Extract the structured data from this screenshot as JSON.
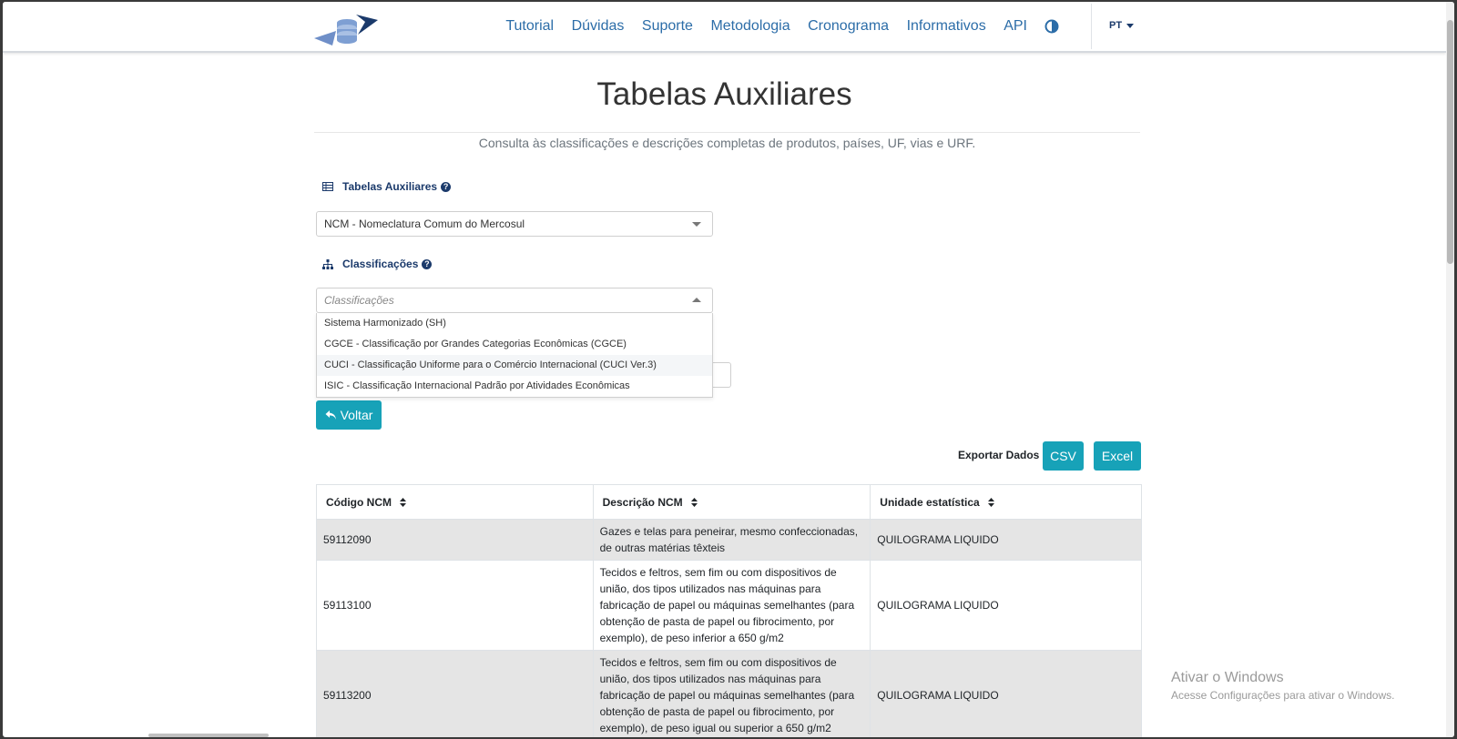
{
  "nav": {
    "links": [
      "Tutorial",
      "Dúvidas",
      "Suporte",
      "Metodologia",
      "Cronograma",
      "Informativos",
      "API"
    ],
    "lang": "PT"
  },
  "page": {
    "title": "Tabelas Auxiliares",
    "subtitle": "Consulta às classificações e descrições completas de produtos, países, UF, vias e URF."
  },
  "tabelas": {
    "label": "Tabelas Auxiliares",
    "selected": "NCM - Nomeclatura Comum do Mercosul"
  },
  "classificacoes": {
    "label": "Classificações",
    "placeholder": "Classificações",
    "options": [
      "Sistema Harmonizado (SH)",
      "CGCE - Classificação por Grandes Categorias Econômicas (CGCE)",
      "CUCI - Classificação Uniforme para o Comércio Internacional (CUCI Ver.3)",
      "ISIC - Classificação Internacional Padrão por Atividades Econômicas"
    ]
  },
  "buttons": {
    "voltar": "Voltar",
    "export_label": "Exportar Dados",
    "csv": "CSV",
    "excel": "Excel"
  },
  "table": {
    "headers": [
      "Código NCM",
      "Descrição NCM",
      "Unidade estatística"
    ],
    "rows": [
      [
        "59112090",
        "Gazes e telas para peneirar, mesmo confeccionadas, de outras matérias têxteis",
        "QUILOGRAMA LIQUIDO"
      ],
      [
        "59113100",
        "Tecidos e feltros, sem fim ou com dispositivos de união, dos tipos utilizados nas máquinas para fabricação de papel ou máquinas semelhantes (para obtenção de pasta de papel ou fibrocimento, por exemplo), de peso inferior a 650 g/m2",
        "QUILOGRAMA LIQUIDO"
      ],
      [
        "59113200",
        "Tecidos e feltros, sem fim ou com dispositivos de união, dos tipos utilizados nas máquinas para fabricação de papel ou máquinas semelhantes (para obtenção de pasta de papel ou fibrocimento, por exemplo), de peso igual ou superior a 650 g/m2",
        "QUILOGRAMA LIQUIDO"
      ]
    ]
  },
  "watermark": {
    "title": "Ativar o Windows",
    "subtitle": "Acesse Configurações para ativar o Windows."
  },
  "colors": {
    "accent": "#17a2b8",
    "nav_link": "#2c6da8",
    "navy": "#1b3a6b"
  }
}
